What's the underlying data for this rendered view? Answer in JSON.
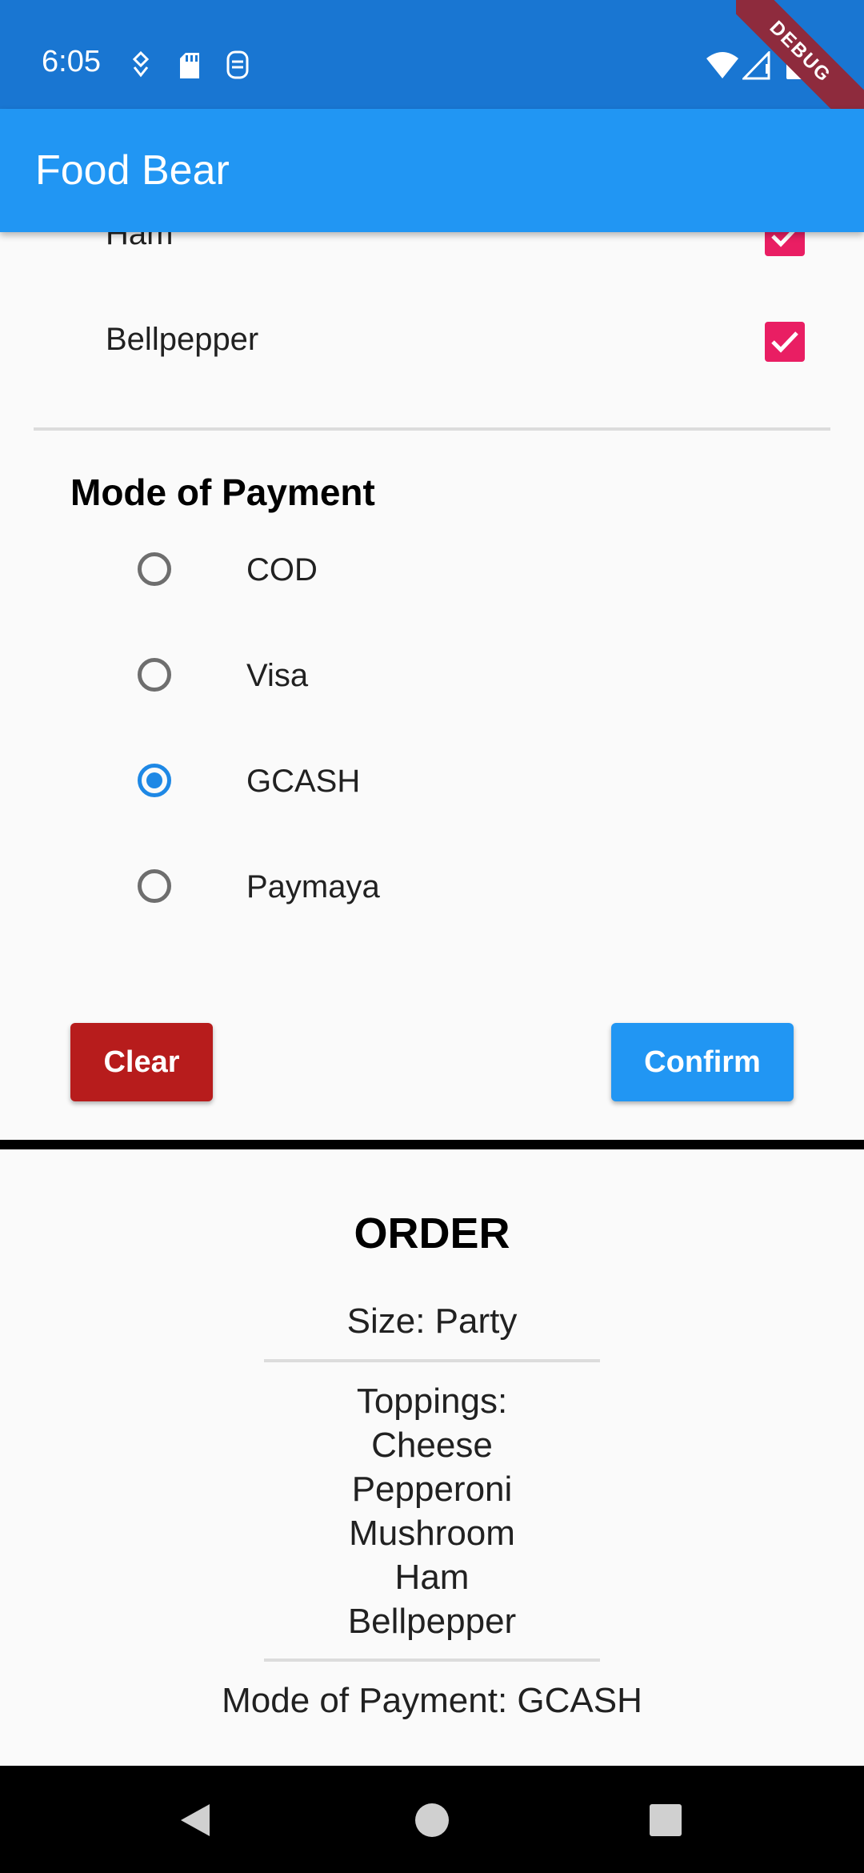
{
  "status_bar": {
    "time": "6:05",
    "left_icons": [
      "location-sync-icon",
      "sd-card-icon",
      "sim-icon"
    ],
    "right_icons": [
      "wifi-icon",
      "cell-signal-icon",
      "battery-icon"
    ],
    "debug_label": "DEBUG"
  },
  "app_bar": {
    "title": "Food Bear"
  },
  "toppings": {
    "items": [
      {
        "label": "Ham",
        "checked": true
      },
      {
        "label": "Bellpepper",
        "checked": true
      }
    ]
  },
  "payment": {
    "heading": "Mode of Payment",
    "options": [
      {
        "label": "COD",
        "selected": false
      },
      {
        "label": "Visa",
        "selected": false
      },
      {
        "label": "GCASH",
        "selected": true
      },
      {
        "label": "Paymaya",
        "selected": false
      }
    ]
  },
  "buttons": {
    "clear_label": "Clear",
    "confirm_label": "Confirm"
  },
  "order": {
    "title": "ORDER",
    "size_text": "Size: Party",
    "toppings_heading": "Toppings:",
    "toppings": [
      "Cheese",
      "Pepperoni",
      "Mushroom",
      "Ham",
      "Bellpepper"
    ],
    "payment_text": "Mode of Payment: GCASH"
  },
  "nav_bar": {
    "icons": [
      "back-icon",
      "home-icon",
      "recents-icon"
    ]
  },
  "colors": {
    "status_bar": "#1976d2",
    "app_bar": "#2196f3",
    "checkbox": "#e91e63",
    "radio_selected": "#1e88e5",
    "clear_button": "#b71c1c",
    "confirm_button": "#2196f3"
  }
}
